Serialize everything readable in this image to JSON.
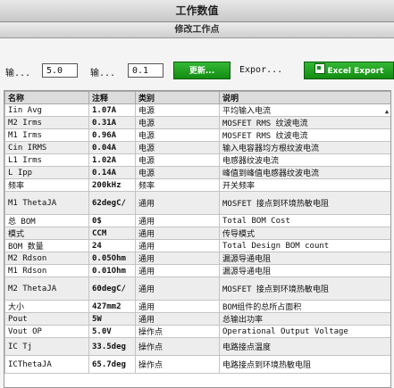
{
  "window": {
    "title": "工作数值",
    "subtitle": "修改工作点"
  },
  "toolbar": {
    "label1": "输...",
    "input1": "5.0",
    "label2": "输...",
    "input2": "0.1",
    "update_button": "更新...",
    "export_label": "Expor...",
    "excel_button": "Excel Export"
  },
  "table": {
    "columns": [
      "名称",
      "注释",
      "类别",
      "说明"
    ],
    "rows": [
      [
        "Iin Avg",
        "1.07A",
        "电源",
        "平均输入电流"
      ],
      [
        "M2 Irms",
        "0.31A",
        "电源",
        "MOSFET RMS 纹波电流"
      ],
      [
        "M1 Irms",
        "0.96A",
        "电源",
        "MOSFET RMS 纹波电流"
      ],
      [
        "Cin IRMS",
        "0.04A",
        "电源",
        "输入电容器均方根纹波电流"
      ],
      [
        "L1 Irms",
        "1.02A",
        "电源",
        "电感器纹波电流"
      ],
      [
        "L Ipp",
        "0.14A",
        "电源",
        "峰值到峰值电感器纹波电流"
      ],
      [
        "频率",
        "200kHz",
        "频率",
        "开关频率"
      ],
      [
        "M1 ThetaJA",
        "62degC/",
        "通用",
        "MOSFET 接点到环境热敏电阻"
      ],
      [
        "总 BOM",
        "0$",
        "通用",
        "Total BOM Cost"
      ],
      [
        "模式",
        "CCM",
        "通用",
        "传导模式"
      ],
      [
        "BOM 数量",
        "24",
        "通用",
        "Total Design BOM count"
      ],
      [
        "M2 Rdson",
        "0.05Ohm",
        "通用",
        "漏源导通电阻"
      ],
      [
        "M1 Rdson",
        "0.01Ohm",
        "通用",
        "漏源导通电阻"
      ],
      [
        "M2 ThetaJA",
        "60degC/",
        "通用",
        "MOSFET 接点到环境热敏电阻"
      ],
      [
        "大小",
        "427mm2",
        "通用",
        "BOM组件的总所占面积"
      ],
      [
        "Pout",
        "5W",
        "通用",
        "总输出功率"
      ],
      [
        "Vout OP",
        "5.0V",
        "操作点",
        "Operational Output Voltage"
      ],
      [
        "IC Tj",
        "33.5deg",
        "操作点",
        "电路接点温度"
      ],
      [
        "ICThetaJA",
        "65.7deg",
        "操作点",
        "电路接点到环境热敏电阻"
      ]
    ]
  }
}
